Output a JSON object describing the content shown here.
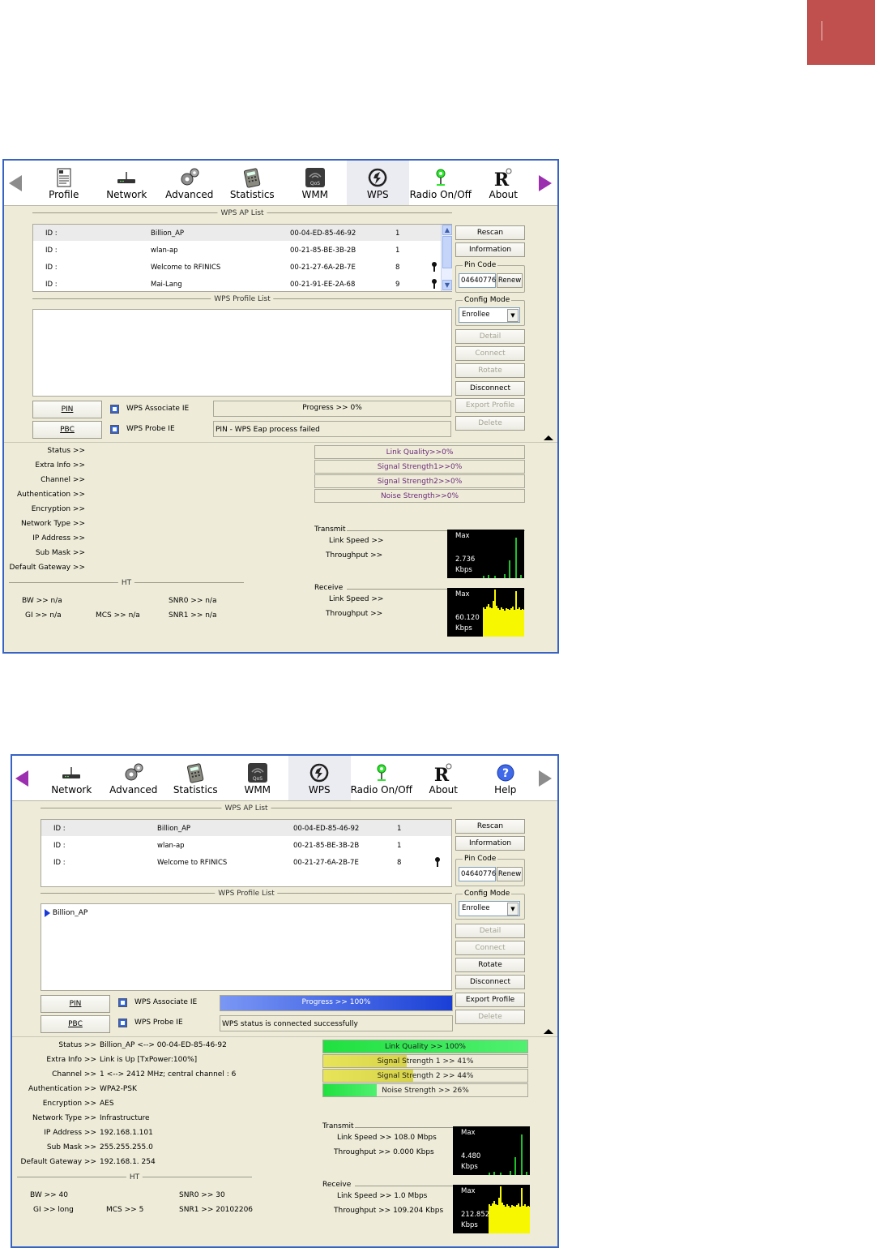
{
  "toolbar1": {
    "items": [
      {
        "label": "Profile",
        "icon": "profile-icon"
      },
      {
        "label": "Network",
        "icon": "network-icon"
      },
      {
        "label": "Advanced",
        "icon": "advanced-icon"
      },
      {
        "label": "Statistics",
        "icon": "statistics-icon"
      },
      {
        "label": "WMM",
        "icon": "wmm-icon"
      },
      {
        "label": "WPS",
        "icon": "wps-icon"
      },
      {
        "label": "Radio On/Off",
        "icon": "radio-icon"
      },
      {
        "label": "About",
        "icon": "about-icon"
      }
    ]
  },
  "toolbar2": {
    "items": [
      {
        "label": "Network",
        "icon": "network-icon"
      },
      {
        "label": "Advanced",
        "icon": "advanced-icon"
      },
      {
        "label": "Statistics",
        "icon": "statistics-icon"
      },
      {
        "label": "WMM",
        "icon": "wmm-icon"
      },
      {
        "label": "WPS",
        "icon": "wps-icon"
      },
      {
        "label": "Radio On/Off",
        "icon": "radio-icon"
      },
      {
        "label": "About",
        "icon": "about-icon"
      },
      {
        "label": "Help",
        "icon": "help-icon"
      }
    ]
  },
  "labels": {
    "ap_list": "WPS AP List",
    "profile_list": "WPS Profile List",
    "rescan": "Rescan",
    "information": "Information",
    "pin_code": "Pin Code",
    "renew": "Renew",
    "config_mode": "Config Mode",
    "detail": "Detail",
    "connect": "Connect",
    "rotate": "Rotate",
    "disconnect": "Disconnect",
    "export_profile": "Export Profile",
    "delete": "Delete",
    "pin": "PIN",
    "pbc": "PBC",
    "assoc_ie": "WPS Associate IE",
    "probe_ie": "WPS Probe IE",
    "id": "ID :",
    "ht": "HT",
    "transmit": "Transmit",
    "receive": "Receive",
    "link_speed": "Link Speed >>",
    "throughput": "Throughput >>",
    "max": "Max",
    "kbps": "Kbps",
    "status": "Status >>",
    "extra_info": "Extra Info >>",
    "channel": "Channel >>",
    "authentication": "Authentication >>",
    "encryption": "Encryption >>",
    "network_type": "Network Type >>",
    "ip_address": "IP Address >>",
    "sub_mask": "Sub Mask >>",
    "default_gateway": "Default Gateway >>"
  },
  "panel1": {
    "ap_rows": [
      {
        "ssid": "Billion_AP",
        "bssid": "00-04-ED-85-46-92",
        "ch": "1",
        "key": false
      },
      {
        "ssid": "wlan-ap",
        "bssid": "00-21-85-BE-3B-2B",
        "ch": "1",
        "key": false
      },
      {
        "ssid": "Welcome to RFINICS",
        "bssid": "00-21-27-6A-2B-7E",
        "ch": "8",
        "key": true
      },
      {
        "ssid": "Mai-Lang",
        "bssid": "00-21-91-EE-2A-68",
        "ch": "9",
        "key": true
      }
    ],
    "pin_value": "04640776",
    "config_value": "Enrollee",
    "progress": "Progress >> 0%",
    "progress_fill": 0,
    "message": "PIN - WPS Eap process failed",
    "link_quality": "Link Quality>>0%",
    "signal1": "Signal Strength1>>0%",
    "signal2": "Signal Strength2>>0%",
    "noise": "Noise Strength>>0%",
    "bw": "BW >> n/a",
    "gi": "GI >> n/a",
    "mcs": "MCS >> n/a",
    "snr0": "SNR0 >> n/a",
    "snr1": "SNR1 >> n/a",
    "tx_rate": "2.736",
    "rx_rate": "60.120"
  },
  "panel2": {
    "ap_rows": [
      {
        "ssid": "Billion_AP",
        "bssid": "00-04-ED-85-46-92",
        "ch": "1",
        "key": false
      },
      {
        "ssid": "wlan-ap",
        "bssid": "00-21-85-BE-3B-2B",
        "ch": "1",
        "key": false
      },
      {
        "ssid": "Welcome to RFINICS",
        "bssid": "00-21-27-6A-2B-7E",
        "ch": "8",
        "key": true
      }
    ],
    "profile_entry": "Billion_AP",
    "pin_value": "04640776",
    "config_value": "Enrollee",
    "progress": "Progress >> 100%",
    "progress_fill": 100,
    "message": "WPS status is connected successfully",
    "link_quality": "Link Quality >> 100%",
    "link_quality_fill": 100,
    "signal1": "Signal Strength 1 >> 41%",
    "signal1_fill": 41,
    "signal2": "Signal Strength 2 >> 44%",
    "signal2_fill": 44,
    "noise": "Noise Strength >> 26%",
    "noise_fill": 26,
    "status": "Billion_AP <--> 00-04-ED-85-46-92",
    "extra_info": "Link is Up [TxPower:100%]",
    "channel": "1 <--> 2412 MHz; central channel : 6",
    "authentication": "WPA2-PSK",
    "encryption": "AES",
    "network_type": "Infrastructure",
    "ip_address": "192.168.1.101",
    "sub_mask": "255.255.255.0",
    "default_gateway": "192.168.1. 254",
    "bw": "BW >> 40",
    "gi": "GI >> long",
    "mcs": "MCS >> 5",
    "snr0": "SNR0 >> 30",
    "snr1": "SNR1 >> 20102206",
    "tx_link_speed": "Link Speed >> 108.0 Mbps",
    "tx_throughput": "Throughput >> 0.000 Kbps",
    "rx_link_speed": "Link Speed >> 1.0 Mbps",
    "rx_throughput": "Throughput >> 109.204 Kbps",
    "tx_rate": "4.480",
    "rx_rate": "212.852"
  },
  "colors": {
    "frame": "#3763c4",
    "panel": "#eeecd8",
    "accent": "#c0504d",
    "graph_tx": "#1fc12a",
    "graph_rx": "#f7f700"
  }
}
